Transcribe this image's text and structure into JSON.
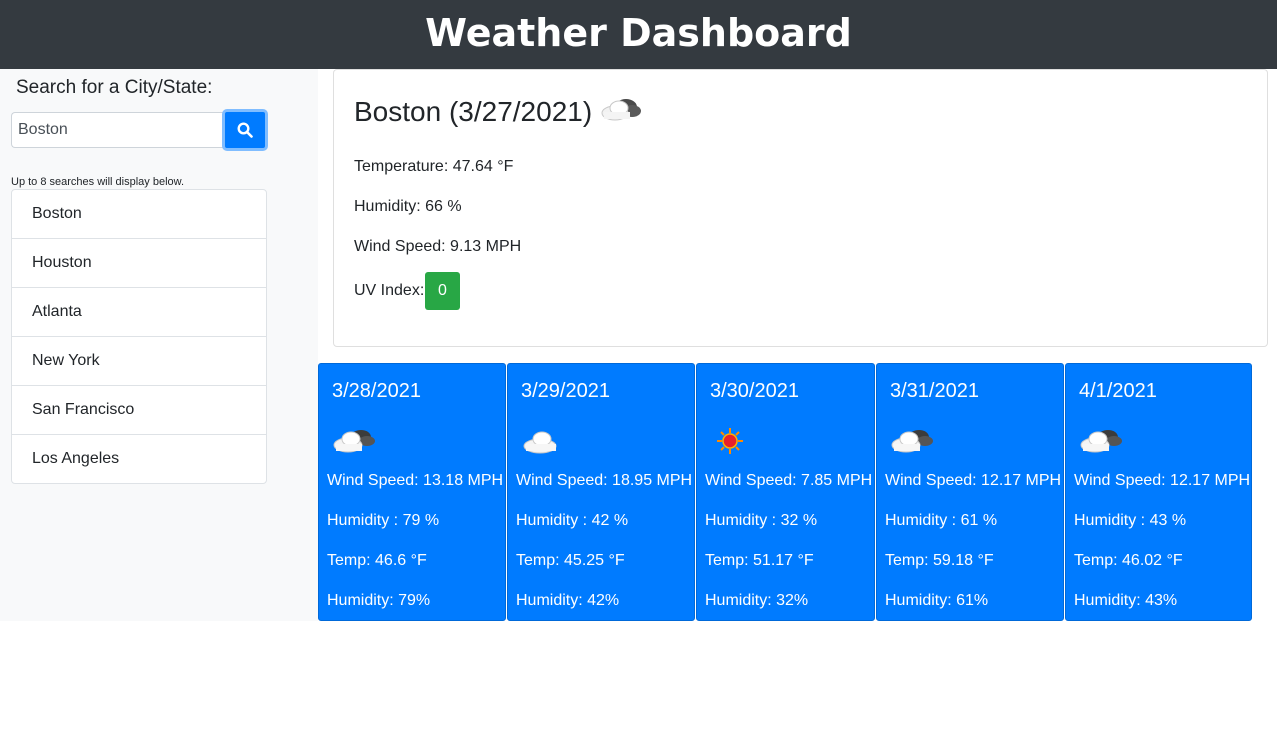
{
  "header": {
    "title": "Weather Dashboard"
  },
  "search": {
    "label": "Search for a City/State:",
    "value": "Boston",
    "hint": "Up to 8 searches will display below."
  },
  "history": [
    "Boston",
    "Houston",
    "Atlanta",
    "New York",
    "San Francisco",
    "Los Angeles"
  ],
  "current": {
    "title": "Boston (3/27/2021)",
    "icon": "cloud-icon",
    "temperature": "Temperature: 47.64 °F",
    "humidity": "Humidity: 66 %",
    "wind": "Wind Speed: 9.13 MPH",
    "uv_label": "UV Index:",
    "uv_value": "0",
    "uv_color": "#28a745"
  },
  "forecast": [
    {
      "date": "3/28/2021",
      "icon": "cloud-icon",
      "wind": "Wind Speed: 13.18 MPH",
      "humidity1": "Humidity : 79 %",
      "temp": "Temp: 46.6 °F",
      "humidity2": "Humidity: 79%"
    },
    {
      "date": "3/29/2021",
      "icon": "cloud-light-icon",
      "wind": "Wind Speed: 18.95 MPH",
      "humidity1": "Humidity : 42 %",
      "temp": "Temp: 45.25 °F",
      "humidity2": "Humidity: 42%"
    },
    {
      "date": "3/30/2021",
      "icon": "sun-icon",
      "wind": "Wind Speed: 7.85 MPH",
      "humidity1": "Humidity : 32 %",
      "temp": "Temp: 51.17 °F",
      "humidity2": "Humidity: 32%"
    },
    {
      "date": "3/31/2021",
      "icon": "cloud-icon",
      "wind": "Wind Speed: 12.17 MPH",
      "humidity1": "Humidity : 61 %",
      "temp": "Temp: 59.18 °F",
      "humidity2": "Humidity: 61%"
    },
    {
      "date": "4/1/2021",
      "icon": "cloud-icon",
      "wind": "Wind Speed: 12.17 MPH",
      "humidity1": "Humidity : 43 %",
      "temp": "Temp: 46.02 °F",
      "humidity2": "Humidity: 43%"
    }
  ],
  "colors": {
    "header": "#343a40",
    "primary": "#007bff",
    "success": "#28a745",
    "sidebar": "#f8f9fa"
  }
}
